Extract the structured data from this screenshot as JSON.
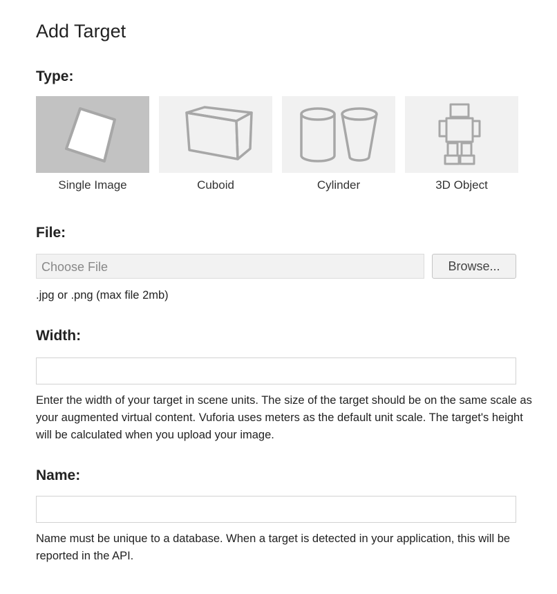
{
  "page": {
    "title": "Add Target"
  },
  "type_section": {
    "label": "Type:",
    "options": [
      {
        "label": "Single Image",
        "icon": "single-image-icon",
        "selected": true
      },
      {
        "label": "Cuboid",
        "icon": "cuboid-icon",
        "selected": false
      },
      {
        "label": "Cylinder",
        "icon": "cylinder-icon",
        "selected": false
      },
      {
        "label": "3D Object",
        "icon": "3d-object-icon",
        "selected": false
      }
    ]
  },
  "file_section": {
    "label": "File:",
    "placeholder": "Choose File",
    "browse_label": "Browse...",
    "hint": ".jpg or .png (max file 2mb)"
  },
  "width_section": {
    "label": "Width:",
    "value": "",
    "hint": "Enter the width of your target in scene units. The size of the target should be on the same scale as your augmented virtual content. Vuforia uses meters as the default unit scale. The target's height will be calculated when you upload your image."
  },
  "name_section": {
    "label": "Name:",
    "value": "",
    "hint": "Name must be unique to a database. When a target is detected in your application, this will be reported in the API."
  },
  "colors": {
    "tile_background": "#f1f1f1",
    "tile_selected_background": "#c2c2c2",
    "icon_stroke": "#a7a7a7"
  }
}
